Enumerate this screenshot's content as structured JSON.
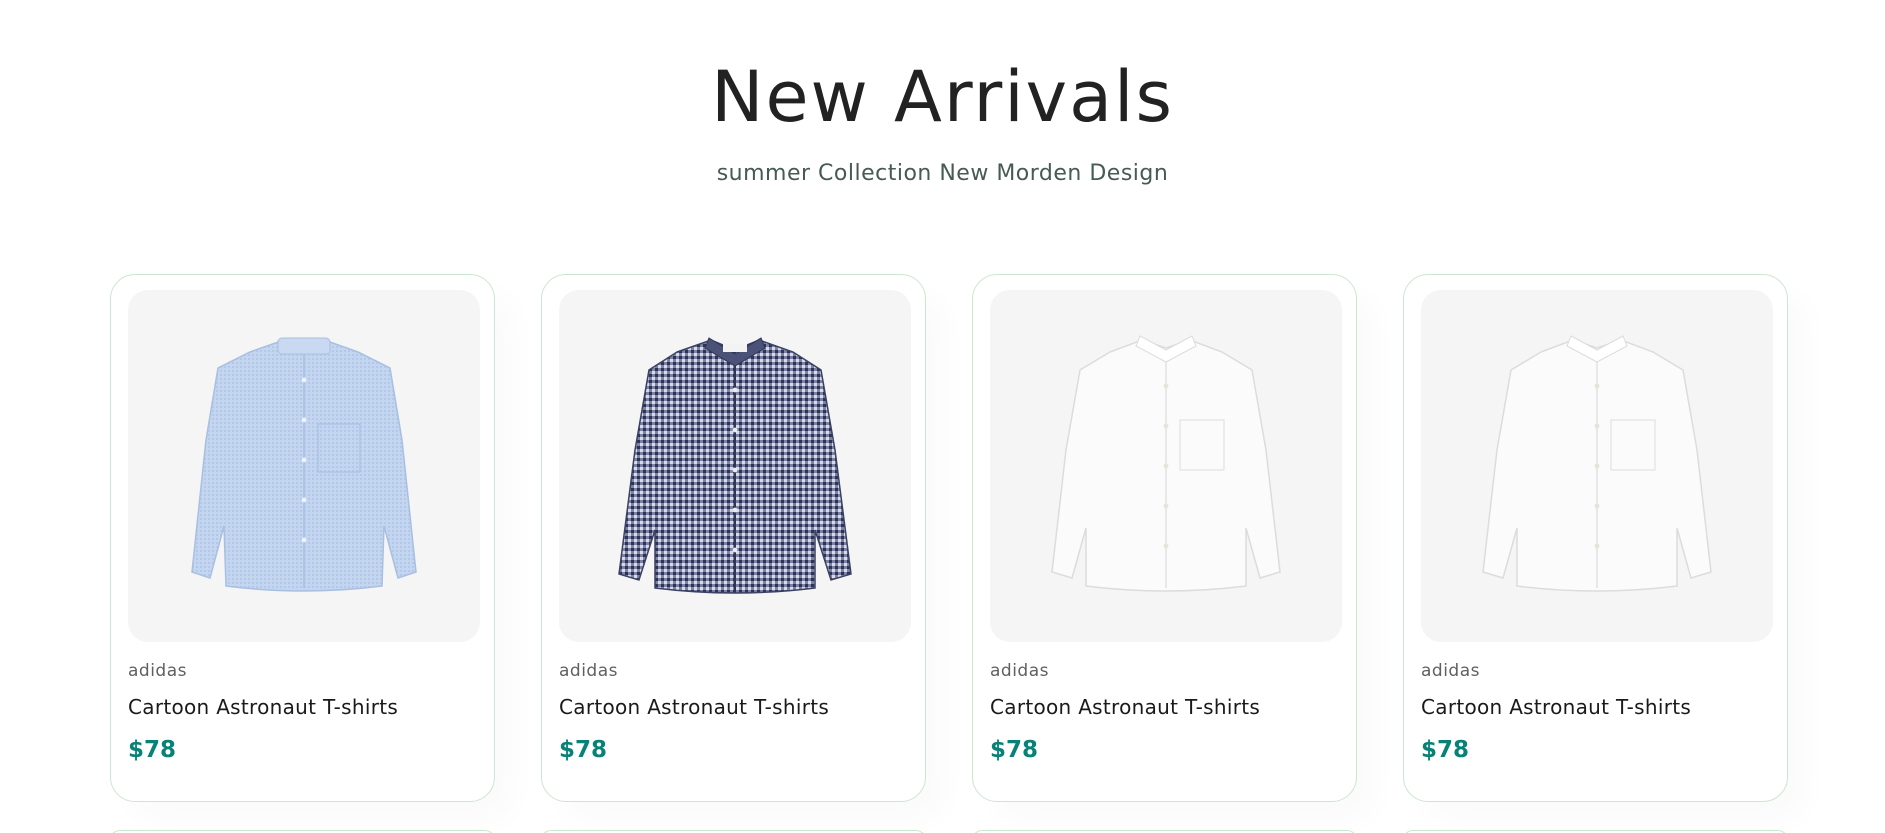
{
  "section": {
    "title": "New Arrivals",
    "subtitle": "summer Collection New Morden Design"
  },
  "products": [
    {
      "brand": "adidas",
      "name": "Cartoon Astronaut T-shirts",
      "price": "$78",
      "image": "light-blue-shirt-icon"
    },
    {
      "brand": "adidas",
      "name": "Cartoon Astronaut T-shirts",
      "price": "$78",
      "image": "navy-gingham-shirt-icon"
    },
    {
      "brand": "adidas",
      "name": "Cartoon Astronaut T-shirts",
      "price": "$78",
      "image": "white-shirt-icon"
    },
    {
      "brand": "adidas",
      "name": "Cartoon Astronaut T-shirts",
      "price": "$78",
      "image": "white-shirt-icon"
    }
  ],
  "colors": {
    "accent": "#088178",
    "card_border": "#cce7d0",
    "image_bg": "#f5f5f5",
    "title": "#222222",
    "subtitle": "#465b52"
  }
}
